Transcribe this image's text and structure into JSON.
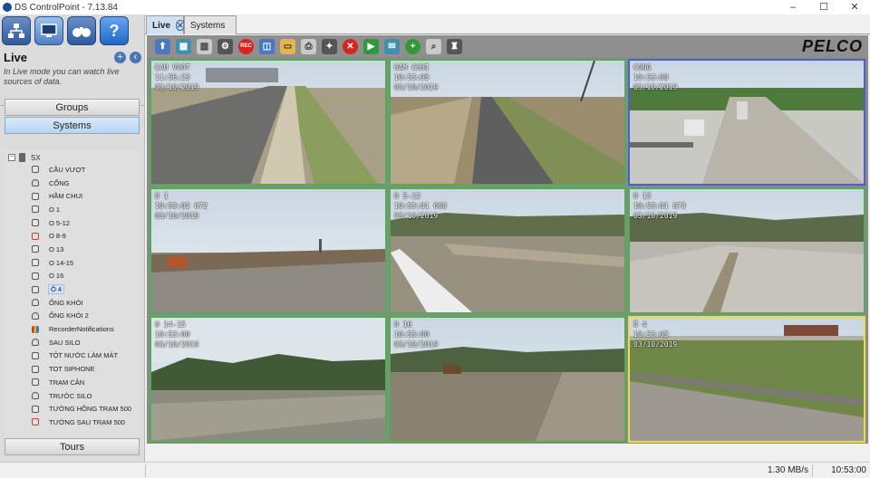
{
  "window": {
    "title": "DS ControlPoint - 7.13.84",
    "min": "–",
    "max": "☐",
    "close": "✕"
  },
  "sidebar": {
    "nav_buttons": [
      "network-icon",
      "monitor-icon",
      "binoculars-icon",
      "help-icon"
    ],
    "section_title": "Live",
    "description": "In Live mode you can watch live sources of data.",
    "groups_label": "Groups",
    "systems_label": "Systems",
    "tours_label": "Tours",
    "tree_root": "SX",
    "tree_items": [
      {
        "label": "CẦU VƯỢT",
        "icon": "cam"
      },
      {
        "label": "CỔNG",
        "icon": "dome"
      },
      {
        "label": "HẦM CHUI",
        "icon": "cam"
      },
      {
        "label": "O 1",
        "icon": "cam"
      },
      {
        "label": "O 5-12",
        "icon": "cam"
      },
      {
        "label": "O 8-9",
        "icon": "cam-err"
      },
      {
        "label": "O 13",
        "icon": "cam"
      },
      {
        "label": "O 14-15",
        "icon": "cam"
      },
      {
        "label": "O 16",
        "icon": "cam"
      },
      {
        "label": "Ô 4",
        "icon": "cam",
        "selected": true
      },
      {
        "label": "ỐNG KHÓI",
        "icon": "dome"
      },
      {
        "label": "ỐNG KHÓI 2",
        "icon": "dome"
      },
      {
        "label": "RecorderNotifications",
        "icon": "rec"
      },
      {
        "label": "SAU SILO",
        "icon": "dome"
      },
      {
        "label": "TỘT NƯỚC LÀM MÁT",
        "icon": "cam"
      },
      {
        "label": "TOT SIPHONE",
        "icon": "cam"
      },
      {
        "label": "TRẠM CÂN",
        "icon": "cam"
      },
      {
        "label": "TRƯỚC SILO",
        "icon": "dome"
      },
      {
        "label": "TƯỜNG HỒNG TRẠM 500",
        "icon": "cam"
      },
      {
        "label": "TƯỜNG SAU TRẠM 500",
        "icon": "cam-err"
      }
    ]
  },
  "tabs": [
    {
      "label": "Live",
      "active": true,
      "close": "✕"
    },
    {
      "label": "Systems",
      "active": false
    }
  ],
  "toolbar": {
    "rec_label": "REC",
    "icons": [
      "arrow-up-icon",
      "layout-2x2-icon",
      "layout-grid-icon",
      "network-icon",
      "record-button-icon",
      "snapshot-icon",
      "folder-icon",
      "print-icon",
      "ptz-icon",
      "stop-icon",
      "bookmark-icon",
      "mail-icon",
      "add-icon",
      "zoom-icon",
      "joystick-icon"
    ],
    "brand": "PELCO"
  },
  "cameras": [
    {
      "name": "CAU VUOT",
      "time": "11:56:23",
      "date": "03/10/2019",
      "scene": "road",
      "border": "green"
    },
    {
      "name": "HAM CHUI",
      "time": "10:53:05",
      "date": "03/10/2019",
      "scene": "road2",
      "border": "green"
    },
    {
      "name": "CONG",
      "time": "10:53:08",
      "date": "03/10/2019",
      "scene": "gate",
      "border": "blue"
    },
    {
      "name": "O 1",
      "time": "10:53:02 672",
      "date": "03/10/2019",
      "scene": "field",
      "border": "green"
    },
    {
      "name": "O 5-12",
      "time": "10:53:01 668",
      "date": "03/10/2019",
      "scene": "pond",
      "border": "green"
    },
    {
      "name": "O 13",
      "time": "10:53:01 673",
      "date": "03/10/2019",
      "scene": "pond2",
      "border": "green"
    },
    {
      "name": "O 14-15",
      "time": "10:53:00",
      "date": "03/10/2019",
      "scene": "hills",
      "border": "green"
    },
    {
      "name": "O 16",
      "time": "10:53:00",
      "date": "03/10/2019",
      "scene": "dig",
      "border": "green"
    },
    {
      "name": "Ô 4",
      "time": "10:53:05",
      "date": "03/10/2019",
      "scene": "slope",
      "border": "yellow"
    }
  ],
  "status": {
    "rate": "1.30 MB/s",
    "time": "10:53:00"
  }
}
